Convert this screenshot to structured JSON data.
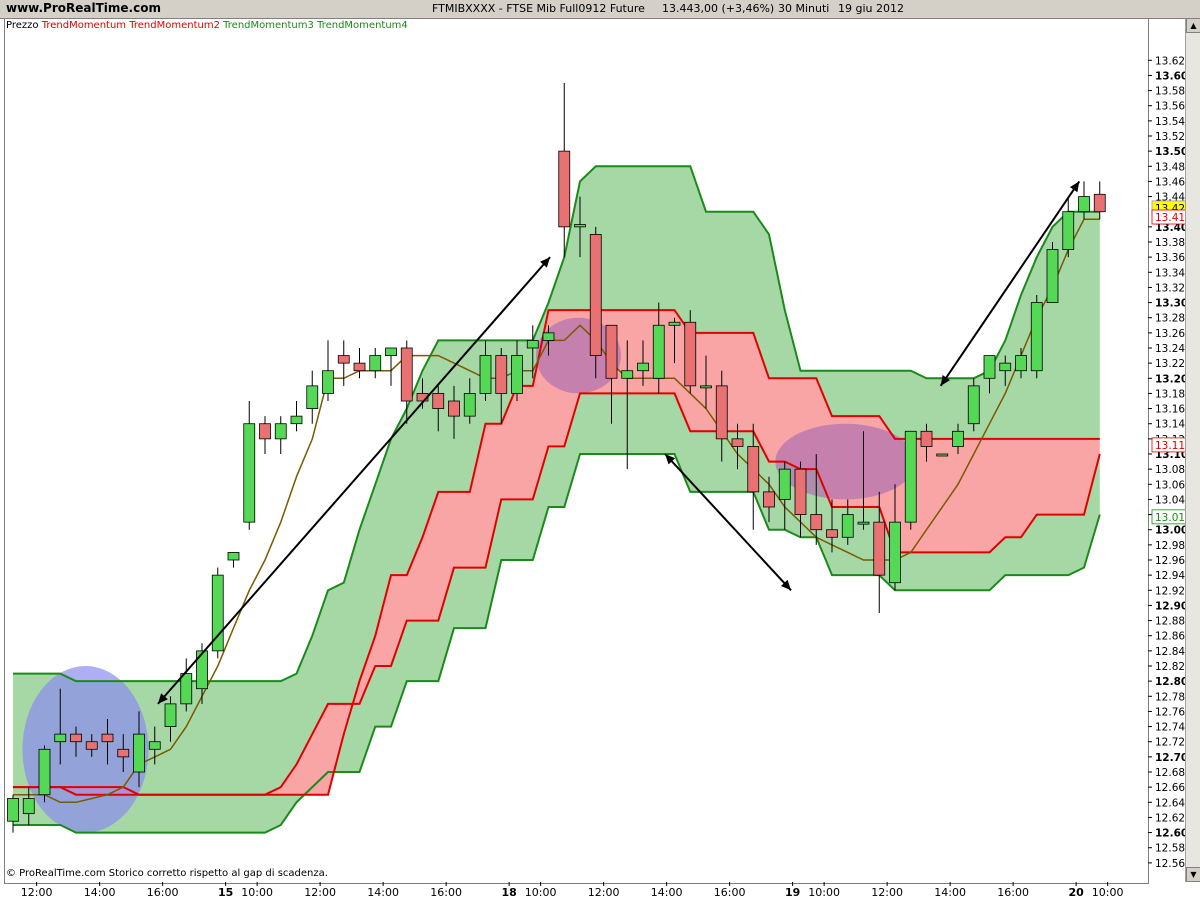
{
  "header": {
    "site": "www.ProRealTime.com",
    "symbol": "FTMIBXXXX - FTSE Mib Full0912 Future",
    "price": "13.443,00 (+3,46%)",
    "interval": "30 Minuti",
    "date": "19 giu 2012"
  },
  "legend": [
    {
      "label": "Prezzo",
      "color": "#000000"
    },
    {
      "label": "TrendMomentum",
      "color": "#e00000"
    },
    {
      "label": "TrendMomentum2",
      "color": "#e00000"
    },
    {
      "label": "TrendMomentum3",
      "color": "#1a8a1a"
    },
    {
      "label": "TrendMomentum4",
      "color": "#1a8a1a"
    }
  ],
  "footer": "© ProRealTime.com  Storico corretto rispetto al gap di scadenza.",
  "price_tags": [
    {
      "value": 13425,
      "label": "13.425,0",
      "bg": "#ffff00",
      "fg": "#000000"
    },
    {
      "value": 13413,
      "label": "13.413",
      "bg": "#ffffff",
      "fg": "#e00000"
    },
    {
      "value": 13112,
      "label": "13.112",
      "bg": "#ffffff",
      "fg": "#e00000"
    },
    {
      "value": 13017,
      "label": "13.017",
      "bg": "#ffffff",
      "fg": "#1a8a1a"
    }
  ],
  "colors": {
    "up": "#55d855",
    "down": "#e87272",
    "red_line": "#e00000",
    "green_line": "#1a8a1a",
    "red_fill": "#f9a5a5",
    "green_fill": "#a6d8a6",
    "circle_blue": "#8c8cf0",
    "circle_purple": "#b070b0"
  },
  "chart_data": {
    "type": "candlestick",
    "ylim": [
      12540,
      13660
    ],
    "bar_count": 69,
    "y_ticks": [
      {
        "v": 13620,
        "l": "13.620",
        "b": false
      },
      {
        "v": 13600,
        "l": "13.600",
        "b": true
      },
      {
        "v": 13580,
        "l": "13.580",
        "b": false
      },
      {
        "v": 13560,
        "l": "13.560",
        "b": false
      },
      {
        "v": 13540,
        "l": "13.540",
        "b": false
      },
      {
        "v": 13520,
        "l": "13.520",
        "b": false
      },
      {
        "v": 13500,
        "l": "13.500",
        "b": true
      },
      {
        "v": 13480,
        "l": "13.480",
        "b": false
      },
      {
        "v": 13460,
        "l": "13.460",
        "b": false
      },
      {
        "v": 13440,
        "l": "13.440",
        "b": false
      },
      {
        "v": 13400,
        "l": "13.400",
        "b": true
      },
      {
        "v": 13380,
        "l": "13.380",
        "b": false
      },
      {
        "v": 13360,
        "l": "13.360",
        "b": false
      },
      {
        "v": 13340,
        "l": "13.340",
        "b": false
      },
      {
        "v": 13320,
        "l": "13.320",
        "b": false
      },
      {
        "v": 13300,
        "l": "13.300",
        "b": true
      },
      {
        "v": 13280,
        "l": "13.280",
        "b": false
      },
      {
        "v": 13260,
        "l": "13.260",
        "b": false
      },
      {
        "v": 13240,
        "l": "13.240",
        "b": false
      },
      {
        "v": 13220,
        "l": "13.220",
        "b": false
      },
      {
        "v": 13200,
        "l": "13.200",
        "b": true
      },
      {
        "v": 13180,
        "l": "13.180",
        "b": false
      },
      {
        "v": 13160,
        "l": "13.160",
        "b": false
      },
      {
        "v": 13140,
        "l": "13.140",
        "b": false
      },
      {
        "v": 13120,
        "l": "13.120",
        "b": false
      },
      {
        "v": 13100,
        "l": "13.100",
        "b": true
      },
      {
        "v": 13080,
        "l": "13.080",
        "b": false
      },
      {
        "v": 13060,
        "l": "13.060",
        "b": false
      },
      {
        "v": 13040,
        "l": "13.040",
        "b": false
      },
      {
        "v": 13020,
        "l": "13.020",
        "b": false
      },
      {
        "v": 13000,
        "l": "13.000",
        "b": true
      },
      {
        "v": 12980,
        "l": "12.980",
        "b": false
      },
      {
        "v": 12960,
        "l": "12.960",
        "b": false
      },
      {
        "v": 12940,
        "l": "12.940",
        "b": false
      },
      {
        "v": 12920,
        "l": "12.920",
        "b": false
      },
      {
        "v": 12900,
        "l": "12.900",
        "b": true
      },
      {
        "v": 12880,
        "l": "12.880",
        "b": false
      },
      {
        "v": 12860,
        "l": "12.860",
        "b": false
      },
      {
        "v": 12840,
        "l": "12.840",
        "b": false
      },
      {
        "v": 12820,
        "l": "12.820",
        "b": false
      },
      {
        "v": 12800,
        "l": "12.800",
        "b": true
      },
      {
        "v": 12780,
        "l": "12.780",
        "b": false
      },
      {
        "v": 12760,
        "l": "12.760",
        "b": false
      },
      {
        "v": 12740,
        "l": "12.740",
        "b": false
      },
      {
        "v": 12720,
        "l": "12.720",
        "b": false
      },
      {
        "v": 12700,
        "l": "12.700",
        "b": true
      },
      {
        "v": 12680,
        "l": "12.680",
        "b": false
      },
      {
        "v": 12660,
        "l": "12.660",
        "b": false
      },
      {
        "v": 12640,
        "l": "12.640",
        "b": false
      },
      {
        "v": 12620,
        "l": "12.620",
        "b": false
      },
      {
        "v": 12600,
        "l": "12.600",
        "b": true
      },
      {
        "v": 12580,
        "l": "12.580",
        "b": false
      },
      {
        "v": 12560,
        "l": "12.560",
        "b": false
      }
    ],
    "x_ticks": [
      {
        "i": 1.5,
        "l": "12:00",
        "b": false
      },
      {
        "i": 5.5,
        "l": "14:00",
        "b": false
      },
      {
        "i": 9.5,
        "l": "16:00",
        "b": false
      },
      {
        "i": 13.5,
        "l": "15",
        "b": true
      },
      {
        "i": 15.5,
        "l": "10:00",
        "b": false
      },
      {
        "i": 19.5,
        "l": "12:00",
        "b": false
      },
      {
        "i": 23.5,
        "l": "14:00",
        "b": false
      },
      {
        "i": 27.5,
        "l": "16:00",
        "b": false
      },
      {
        "i": 31.5,
        "l": "18",
        "b": true
      },
      {
        "i": 33.5,
        "l": "10:00",
        "b": false
      },
      {
        "i": 37.5,
        "l": "12:00",
        "b": false
      },
      {
        "i": 41.5,
        "l": "14:00",
        "b": false
      },
      {
        "i": 45.5,
        "l": "16:00",
        "b": false
      },
      {
        "i": 49.5,
        "l": "19",
        "b": true
      },
      {
        "i": 51.5,
        "l": "10:00",
        "b": false
      },
      {
        "i": 55.5,
        "l": "12:00",
        "b": false
      },
      {
        "i": 59.5,
        "l": "14:00",
        "b": false
      },
      {
        "i": 63.5,
        "l": "16:00",
        "b": false
      },
      {
        "i": 67.5,
        "l": "20",
        "b": true
      },
      {
        "i": 69.5,
        "l": "10:00",
        "b": false
      }
    ],
    "candles": [
      [
        12615,
        12645,
        12600,
        12650
      ],
      [
        12625,
        12645,
        12610,
        12660
      ],
      [
        12650,
        12710,
        12640,
        12715
      ],
      [
        12720,
        12730,
        12690,
        12790
      ],
      [
        12730,
        12720,
        12700,
        12740
      ],
      [
        12720,
        12710,
        12700,
        12730
      ],
      [
        12730,
        12720,
        12690,
        12750
      ],
      [
        12710,
        12700,
        12680,
        12730
      ],
      [
        12680,
        12730,
        12660,
        12760
      ],
      [
        12710,
        12720,
        12690,
        12740
      ],
      [
        12740,
        12770,
        12720,
        12780
      ],
      [
        12770,
        12810,
        12760,
        12830
      ],
      [
        12790,
        12840,
        12770,
        12850
      ],
      [
        12840,
        12940,
        12830,
        12950
      ],
      [
        12960,
        12970,
        12950,
        12970
      ],
      [
        13010,
        13140,
        13000,
        13170
      ],
      [
        13140,
        13120,
        13100,
        13150
      ],
      [
        13120,
        13140,
        13100,
        13150
      ],
      [
        13140,
        13150,
        13130,
        13170
      ],
      [
        13160,
        13190,
        13140,
        13210
      ],
      [
        13180,
        13210,
        13170,
        13250
      ],
      [
        13230,
        13220,
        13190,
        13250
      ],
      [
        13220,
        13210,
        13200,
        13240
      ],
      [
        13210,
        13230,
        13200,
        13240
      ],
      [
        13230,
        13240,
        13190,
        13240
      ],
      [
        13240,
        13170,
        13140,
        13250
      ],
      [
        13180,
        13170,
        13160,
        13200
      ],
      [
        13180,
        13160,
        13130,
        13190
      ],
      [
        13170,
        13150,
        13120,
        13190
      ],
      [
        13150,
        13180,
        13140,
        13200
      ],
      [
        13180,
        13230,
        13170,
        13250
      ],
      [
        13230,
        13180,
        13140,
        13240
      ],
      [
        13180,
        13230,
        13170,
        13250
      ],
      [
        13240,
        13250,
        13200,
        13270
      ],
      [
        13250,
        13260,
        13230,
        13270
      ],
      [
        13500,
        13400,
        13360,
        13590
      ],
      [
        13400,
        13403,
        13360,
        13440
      ],
      [
        13390,
        13230,
        13200,
        13400
      ],
      [
        13270,
        13200,
        13140,
        13260
      ],
      [
        13200,
        13210,
        13080,
        13250
      ],
      [
        13210,
        13220,
        13190,
        13250
      ],
      [
        13200,
        13270,
        13180,
        13300
      ],
      [
        13270,
        13274,
        13220,
        13280
      ],
      [
        13274,
        13190,
        13180,
        13290
      ],
      [
        13190,
        13190,
        13160,
        13230
      ],
      [
        13190,
        13120,
        13090,
        13210
      ],
      [
        13120,
        13110,
        13080,
        13140
      ],
      [
        13110,
        13050,
        13000,
        13140
      ],
      [
        13050,
        13030,
        13010,
        13070
      ],
      [
        13040,
        13080,
        13000,
        13090
      ],
      [
        13080,
        13020,
        12990,
        13090
      ],
      [
        13020,
        13000,
        12980,
        13100
      ],
      [
        13000,
        12990,
        12970,
        13040
      ],
      [
        12990,
        13020,
        12980,
        13040
      ],
      [
        13010,
        13010,
        13000,
        13130
      ],
      [
        13010,
        12940,
        12890,
        13050
      ],
      [
        12930,
        13010,
        12920,
        13060
      ],
      [
        13010,
        13130,
        13000,
        13130
      ],
      [
        13130,
        13110,
        13090,
        13140
      ],
      [
        13100,
        13100,
        13100,
        13100
      ],
      [
        13110,
        13130,
        13100,
        13140
      ],
      [
        13140,
        13190,
        13130,
        13200
      ],
      [
        13200,
        13230,
        13180,
        13230
      ],
      [
        13210,
        13220,
        13190,
        13230
      ],
      [
        13210,
        13230,
        13200,
        13240
      ],
      [
        13210,
        13300,
        13200,
        13310
      ],
      [
        13300,
        13370,
        13300,
        13380
      ],
      [
        13370,
        13420,
        13360,
        13440
      ],
      [
        13420,
        13440,
        13410,
        13460
      ]
    ],
    "last_candle": [
      13443,
      13420,
      13410,
      13460
    ],
    "red_upper": [
      12660,
      12660,
      12660,
      12660,
      12660,
      12660,
      12660,
      12660,
      12650,
      12650,
      12650,
      12650,
      12650,
      12650,
      12650,
      12650,
      12650,
      12650,
      12650,
      12650,
      12650,
      12730,
      12800,
      12860,
      12940,
      12940,
      12990,
      13050,
      13050,
      13050,
      13140,
      13140,
      13190,
      13190,
      13290,
      13290,
      13290,
      13290,
      13290,
      13290,
      13290,
      13290,
      13290,
      13260,
      13260,
      13260,
      13260,
      13260,
      13200,
      13200,
      13200,
      13200,
      13150,
      13150,
      13150,
      13150,
      13120,
      13120,
      13120,
      13120,
      13120,
      13120,
      13120,
      13120,
      13120,
      13120,
      13120,
      13120,
      13120,
      13120
    ],
    "red_mid": [
      12650,
      12650,
      12650,
      12640,
      12640,
      12645,
      12650,
      12660,
      12690,
      12700,
      12710,
      12740,
      12780,
      12820,
      12870,
      12920,
      12960,
      13010,
      13070,
      13120,
      13200,
      13200,
      13210,
      13210,
      13210,
      13230,
      13230,
      13230,
      13220,
      13210,
      13200,
      13200,
      13210,
      13210,
      13250,
      13250,
      13270,
      13250,
      13220,
      13200,
      13200,
      13200,
      13200,
      13180,
      13160,
      13130,
      13100,
      13080,
      13060,
      13030,
      13010,
      12990,
      12980,
      12970,
      12960,
      12960,
      12960,
      12970,
      13000,
      13030,
      13060,
      13100,
      13140,
      13180,
      13230,
      13280,
      13320,
      13370,
      13410,
      13410
    ],
    "red_lower": [
      12660,
      12660,
      12660,
      12660,
      12650,
      12650,
      12650,
      12650,
      12650,
      12650,
      12650,
      12650,
      12650,
      12650,
      12650,
      12650,
      12650,
      12660,
      12690,
      12730,
      12770,
      12770,
      12770,
      12820,
      12820,
      12880,
      12880,
      12880,
      12950,
      12950,
      12950,
      13040,
      13040,
      13040,
      13110,
      13110,
      13180,
      13180,
      13180,
      13180,
      13180,
      13180,
      13180,
      13130,
      13130,
      13130,
      13130,
      13130,
      13090,
      13090,
      13080,
      13080,
      13030,
      13030,
      13030,
      13030,
      12970,
      12970,
      12970,
      12970,
      12970,
      12970,
      12970,
      12990,
      12990,
      13020,
      13020,
      13020,
      13020,
      13100
    ],
    "green_upper": [
      12810,
      12810,
      12810,
      12810,
      12800,
      12800,
      12800,
      12800,
      12800,
      12800,
      12800,
      12800,
      12800,
      12800,
      12800,
      12800,
      12800,
      12800,
      12810,
      12860,
      12920,
      12930,
      13000,
      13060,
      13120,
      13160,
      13210,
      13250,
      13250,
      13250,
      13250,
      13250,
      13250,
      13250,
      13300,
      13360,
      13460,
      13480,
      13480,
      13480,
      13480,
      13480,
      13480,
      13480,
      13420,
      13420,
      13420,
      13420,
      13390,
      13290,
      13210,
      13210,
      13210,
      13210,
      13210,
      13210,
      13210,
      13210,
      13200,
      13200,
      13200,
      13200,
      13210,
      13250,
      13310,
      13360,
      13400,
      13420,
      13420,
      13420
    ],
    "green_lower": [
      12610,
      12610,
      12610,
      12610,
      12600,
      12600,
      12600,
      12600,
      12600,
      12600,
      12600,
      12600,
      12600,
      12600,
      12600,
      12600,
      12600,
      12610,
      12640,
      12660,
      12680,
      12680,
      12680,
      12740,
      12740,
      12800,
      12800,
      12800,
      12870,
      12870,
      12870,
      12960,
      12960,
      12960,
      13030,
      13030,
      13100,
      13100,
      13100,
      13100,
      13100,
      13100,
      13100,
      13050,
      13050,
      13050,
      13050,
      13050,
      13000,
      13000,
      12990,
      12990,
      12940,
      12940,
      12940,
      12940,
      12920,
      12920,
      12920,
      12920,
      12920,
      12920,
      12920,
      12940,
      12940,
      12940,
      12940,
      12940,
      12950,
      13020
    ],
    "circles": [
      {
        "i0": 0.6,
        "i1": 8.6,
        "v0": 12820,
        "v1": 12600,
        "color": "blue"
      },
      {
        "i0": 33.2,
        "i1": 38.6,
        "v0": 13280,
        "v1": 13180,
        "color": "purple"
      },
      {
        "i0": 48.4,
        "i1": 57.3,
        "v0": 13140,
        "v1": 13040,
        "color": "purple"
      }
    ],
    "arrows": [
      {
        "i0": 9.2,
        "v0": 12770,
        "i1": 34.1,
        "v1": 13360
      },
      {
        "i0": 41.4,
        "v0": 13100,
        "i1": 49.4,
        "v1": 12920
      },
      {
        "i0": 58.9,
        "v0": 13190,
        "i1": 67.7,
        "v1": 13460
      }
    ]
  }
}
